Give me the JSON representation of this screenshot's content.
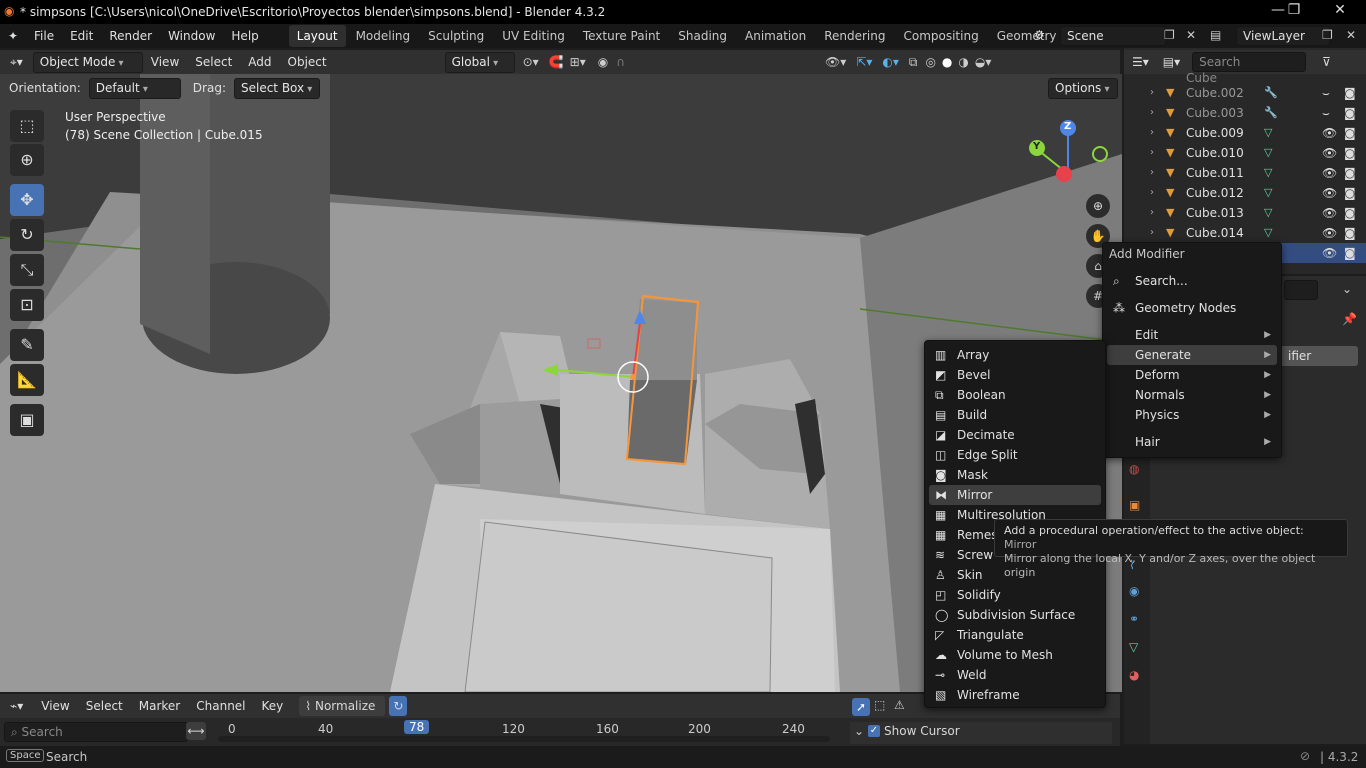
{
  "title_bar": {
    "title": "* simpsons [C:\\Users\\nicol\\OneDrive\\Escritorio\\Proyectos blender\\simpsons.blend] - Blender 4.3.2",
    "minimize": "—",
    "maximize": "❐",
    "close": "✕"
  },
  "menu": {
    "file": "File",
    "edit": "Edit",
    "render": "Render",
    "window": "Window",
    "help": "Help"
  },
  "workspaces": [
    "Layout",
    "Modeling",
    "Sculpting",
    "UV Editing",
    "Texture Paint",
    "Shading",
    "Animation",
    "Rendering",
    "Compositing",
    "Geometry Node"
  ],
  "scene": {
    "name": "Scene",
    "view_layer": "ViewLayer"
  },
  "viewport_header": {
    "mode": "Object Mode",
    "view": "View",
    "select": "Select",
    "add": "Add",
    "object": "Object",
    "orientation": "Global"
  },
  "tool_settings": {
    "orientation_label": "Orientation:",
    "orientation_value": "Default",
    "drag_label": "Drag:",
    "drag_value": "Select Box",
    "options": "Options"
  },
  "viewport": {
    "perspective": "User Perspective",
    "collection": "(78) Scene Collection | Cube.015",
    "gizmo_x": "",
    "gizmo_y": "Y",
    "gizmo_z": "Z"
  },
  "outliner": {
    "search_placeholder": "Search",
    "items": [
      {
        "name": "Cube.002"
      },
      {
        "name": "Cube.003"
      },
      {
        "name": "Cube.009"
      },
      {
        "name": "Cube.010"
      },
      {
        "name": "Cube.011"
      },
      {
        "name": "Cube.012"
      },
      {
        "name": "Cube.013"
      },
      {
        "name": "Cube.014"
      }
    ],
    "partial_top": "Cube"
  },
  "properties": {
    "partial_label": "ifier"
  },
  "add_modifier_menu": {
    "title": "Add Modifier",
    "search": "Search...",
    "geometry_nodes": "Geometry Nodes",
    "categories": [
      "Edit",
      "Generate",
      "Deform",
      "Normals",
      "Physics",
      "Hair"
    ],
    "active_category": "Generate"
  },
  "generate_submenu": {
    "items": [
      "Array",
      "Bevel",
      "Boolean",
      "Build",
      "Decimate",
      "Edge Split",
      "Mask",
      "Mirror",
      "Multiresolution",
      "Remesh",
      "Screw",
      "Skin",
      "Solidify",
      "Subdivision Surface",
      "Triangulate",
      "Volume to Mesh",
      "Weld",
      "Wireframe"
    ],
    "highlighted": "Mirror"
  },
  "tooltip": {
    "line1_prefix": "Add a procedural operation/effect to the active object: ",
    "line1_name": "Mirror",
    "line2": "Mirror along the local X, Y and/or Z axes, over the object origin"
  },
  "timeline": {
    "view": "View",
    "select": "Select",
    "marker": "Marker",
    "channel": "Channel",
    "key": "Key",
    "normalize": "Normalize",
    "search_placeholder": "Search",
    "current_frame": "78",
    "ticks": [
      "0",
      "40",
      "120",
      "160",
      "200",
      "240"
    ],
    "show_cursor": "Show Cursor"
  },
  "status": {
    "space": "Space",
    "search": "Search",
    "version": "4.3.2"
  }
}
